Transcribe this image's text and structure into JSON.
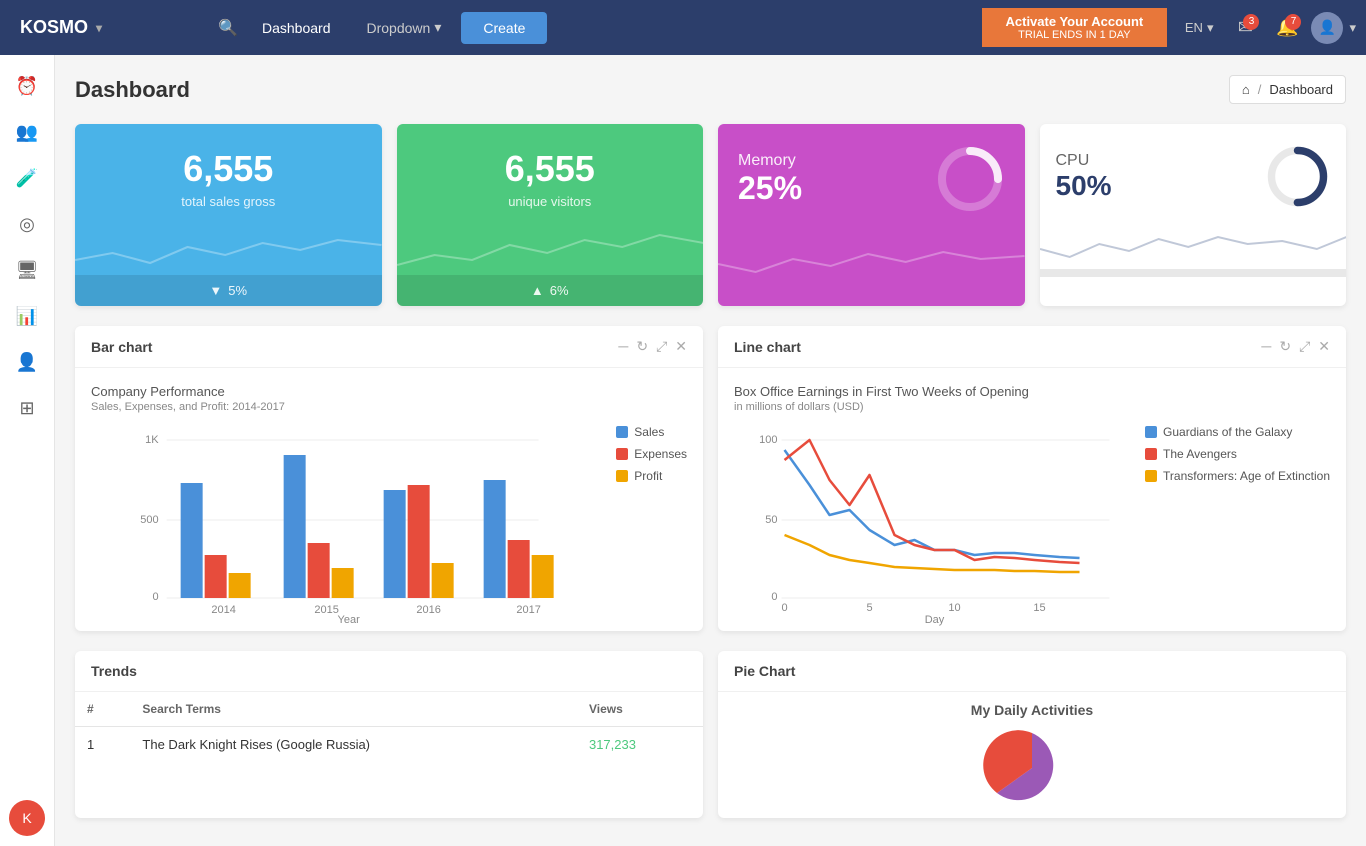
{
  "navbar": {
    "brand": "KOSMO",
    "search_icon": "🔍",
    "nav_items": [
      {
        "label": "Dashboard",
        "active": true
      },
      {
        "label": "Dropdown",
        "has_chevron": true
      }
    ],
    "create_button": "Create",
    "activate": {
      "title": "Activate Your Account",
      "sub": "TRIAL ENDS IN 1 DAY"
    },
    "lang": "EN",
    "notification_count": "3",
    "alert_count": "7",
    "breadcrumb_home": "Dashboard"
  },
  "sidebar": {
    "items": [
      {
        "icon": "⏰",
        "name": "clock"
      },
      {
        "icon": "👥",
        "name": "users"
      },
      {
        "icon": "🧪",
        "name": "flask"
      },
      {
        "icon": "◎",
        "name": "toggle"
      },
      {
        "icon": "🖥️",
        "name": "monitor"
      },
      {
        "icon": "📊",
        "name": "chart"
      },
      {
        "icon": "👤",
        "name": "person"
      },
      {
        "icon": "⊞",
        "name": "grid"
      }
    ]
  },
  "page": {
    "title": "Dashboard",
    "breadcrumb_home_icon": "⌂",
    "breadcrumb_label": "Dashboard"
  },
  "stat_cards": [
    {
      "value": "6,555",
      "label": "total sales gross",
      "footer_icon": "▼",
      "footer_value": "5%",
      "type": "blue"
    },
    {
      "value": "6,555",
      "label": "unique visitors",
      "footer_icon": "▲",
      "footer_value": "6%",
      "type": "green"
    },
    {
      "title": "Memory",
      "value": "25%",
      "type": "purple"
    },
    {
      "title": "CPU",
      "value": "50%",
      "type": "white"
    }
  ],
  "bar_chart": {
    "title": "Bar chart",
    "chart_title": "Company Performance",
    "chart_subtitle": "Sales, Expenses, and Profit: 2014-2017",
    "y_axis_label": "Year",
    "legend": [
      {
        "label": "Sales",
        "color": "#4a90d9"
      },
      {
        "label": "Expenses",
        "color": "#e74c3c"
      },
      {
        "label": "Profit",
        "color": "#f0a500"
      }
    ],
    "years": [
      "2014",
      "2015",
      "2016",
      "2017"
    ],
    "y_labels": [
      "1K",
      "500",
      "0"
    ],
    "actions": [
      "-",
      "↻",
      "⤢",
      "✕"
    ]
  },
  "line_chart": {
    "title": "Line chart",
    "chart_title": "Box Office Earnings in First Two Weeks of Opening",
    "chart_subtitle": "in millions of dollars (USD)",
    "legend": [
      {
        "label": "Guardians of the Galaxy",
        "color": "#4a90d9"
      },
      {
        "label": "The Avengers",
        "color": "#e74c3c"
      },
      {
        "label": "Transformers: Age of Extinction",
        "color": "#f0a500"
      }
    ],
    "y_labels": [
      "100",
      "50",
      "0"
    ],
    "x_labels": [
      "0",
      "5",
      "10",
      "15"
    ],
    "x_axis_label": "Day",
    "actions": [
      "-",
      "↻",
      "⤢",
      "✕"
    ]
  },
  "trends": {
    "title": "Trends",
    "columns": [
      "#",
      "Search Terms",
      "Views"
    ],
    "rows": [
      {
        "num": "1",
        "term": "The Dark Knight Rises (Google Russia)",
        "views": "317,233"
      }
    ]
  },
  "pie_chart": {
    "title": "Pie Chart",
    "chart_title": "My Daily Activities"
  }
}
